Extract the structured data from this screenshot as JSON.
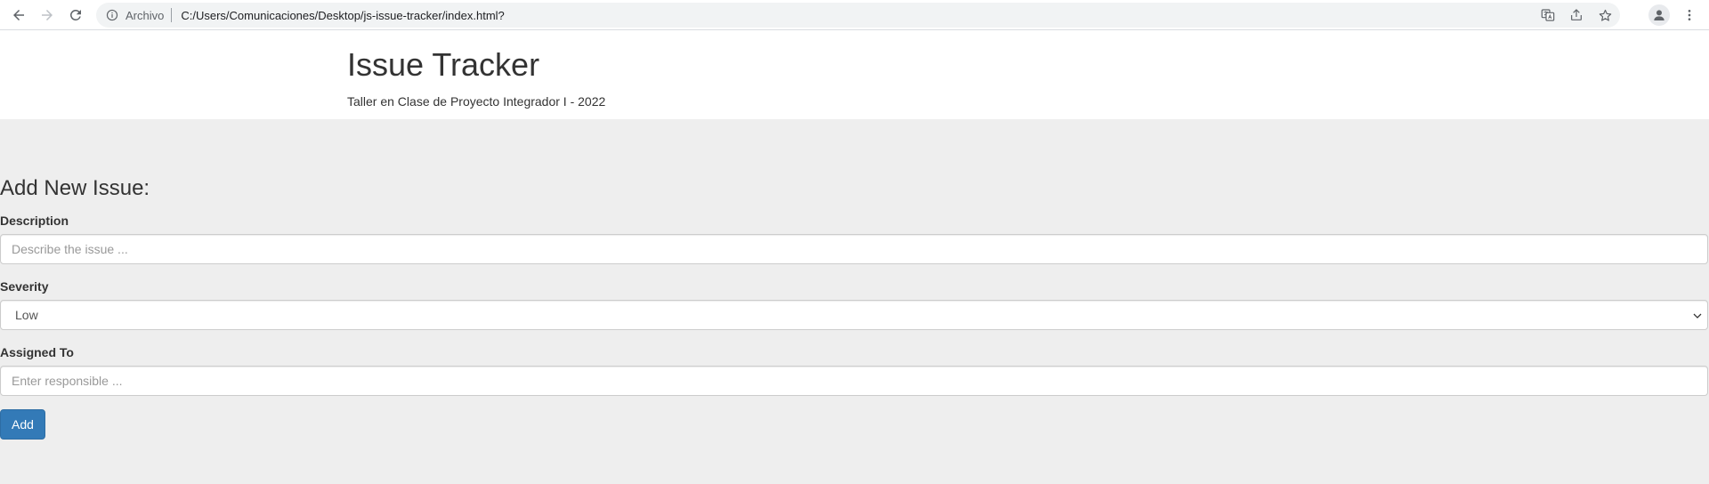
{
  "browser": {
    "scheme_label": "Archivo",
    "url": "C:/Users/Comunicaciones/Desktop/js-issue-tracker/index.html?",
    "icons": {
      "back": "arrow-left-icon",
      "forward": "arrow-right-icon",
      "reload": "reload-icon",
      "site_info": "info-icon",
      "translate": "translate-icon",
      "share": "share-icon",
      "bookmark": "star-icon",
      "profile": "profile-icon",
      "menu": "kebab-menu-icon"
    }
  },
  "header": {
    "title": "Issue Tracker",
    "subtitle": "Taller en Clase de Proyecto Integrador I - 2022"
  },
  "form": {
    "heading": "Add New Issue:",
    "description": {
      "label": "Description",
      "placeholder": "Describe the issue ...",
      "value": ""
    },
    "severity": {
      "label": "Severity",
      "selected": "Low"
    },
    "assigned_to": {
      "label": "Assigned To",
      "placeholder": "Enter responsible ...",
      "value": ""
    },
    "submit_label": "Add"
  },
  "colors": {
    "primary_button": "#337ab7",
    "page_background": "#eeeeee",
    "header_background": "#ffffff",
    "text": "#333333"
  }
}
